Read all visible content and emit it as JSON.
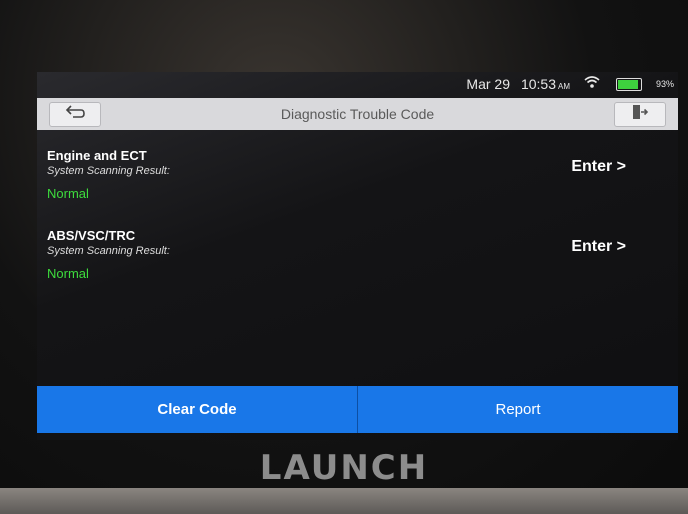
{
  "status_bar": {
    "date": "Mar 29",
    "time": "10:53",
    "ampm": "AM",
    "battery": "93%"
  },
  "title_bar": {
    "title": "Diagnostic Trouble Code"
  },
  "systems": [
    {
      "name": "Engine and ECT",
      "result_label": "System Scanning Result:",
      "result": "Normal",
      "action": "Enter >"
    },
    {
      "name": "ABS/VSC/TRC",
      "result_label": "System Scanning Result:",
      "result": "Normal",
      "action": "Enter >"
    }
  ],
  "bottom_bar": {
    "clear_label": "Clear Code",
    "report_label": "Report"
  },
  "device": {
    "brand": "LAUNCH"
  },
  "colors": {
    "accent": "#1977e8",
    "status_ok": "#3ddc3d"
  }
}
